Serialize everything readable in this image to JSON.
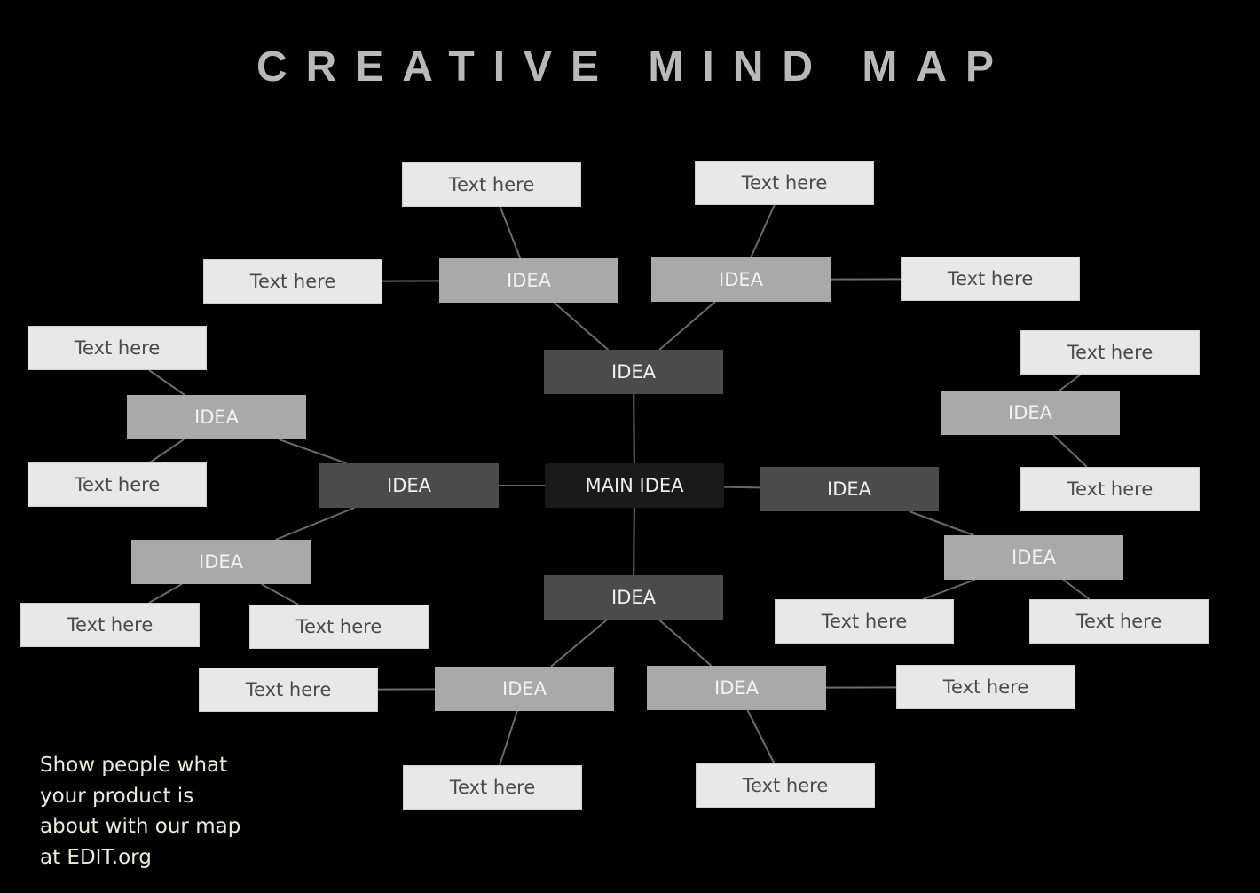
{
  "title": "CREATIVE MIND MAP",
  "colors": {
    "background": "#000000",
    "connector": "#6a6a6a"
  },
  "nodes": [
    {
      "id": "main",
      "label": "MAIN IDEA",
      "kind": "main"
    },
    {
      "id": "top",
      "label": "IDEA",
      "kind": "primary"
    },
    {
      "id": "left",
      "label": "IDEA",
      "kind": "primary"
    },
    {
      "id": "right",
      "label": "IDEA",
      "kind": "primary"
    },
    {
      "id": "bottom",
      "label": "IDEA",
      "kind": "primary"
    },
    {
      "id": "top-sub-left",
      "label": "IDEA",
      "kind": "sub"
    },
    {
      "id": "top-sub-right",
      "label": "IDEA",
      "kind": "sub"
    },
    {
      "id": "left-sub-top",
      "label": "IDEA",
      "kind": "sub"
    },
    {
      "id": "left-sub-bottom",
      "label": "IDEA",
      "kind": "sub"
    },
    {
      "id": "right-sub-top",
      "label": "IDEA",
      "kind": "sub"
    },
    {
      "id": "right-sub-bottom",
      "label": "IDEA",
      "kind": "sub"
    },
    {
      "id": "bottom-sub-left",
      "label": "IDEA",
      "kind": "sub"
    },
    {
      "id": "bottom-sub-right",
      "label": "IDEA",
      "kind": "sub"
    },
    {
      "id": "t1",
      "label": "Text here",
      "kind": "text"
    },
    {
      "id": "t2",
      "label": "Text here",
      "kind": "text"
    },
    {
      "id": "t3",
      "label": "Text here",
      "kind": "text"
    },
    {
      "id": "t4",
      "label": "Text here",
      "kind": "text"
    },
    {
      "id": "t5",
      "label": "Text here",
      "kind": "text"
    },
    {
      "id": "t6",
      "label": "Text here",
      "kind": "text"
    },
    {
      "id": "t7",
      "label": "Text here",
      "kind": "text"
    },
    {
      "id": "t8",
      "label": "Text here",
      "kind": "text"
    },
    {
      "id": "t9",
      "label": "Text here",
      "kind": "text"
    },
    {
      "id": "t10",
      "label": "Text here",
      "kind": "text"
    },
    {
      "id": "t11",
      "label": "Text here",
      "kind": "text"
    },
    {
      "id": "t12",
      "label": "Text here",
      "kind": "text"
    },
    {
      "id": "t13",
      "label": "Text here",
      "kind": "text"
    },
    {
      "id": "t14",
      "label": "Text here",
      "kind": "text"
    },
    {
      "id": "t15",
      "label": "Text here",
      "kind": "text"
    },
    {
      "id": "t16",
      "label": "Text here",
      "kind": "text"
    }
  ],
  "edges": [
    [
      "main",
      "top"
    ],
    [
      "main",
      "left"
    ],
    [
      "main",
      "right"
    ],
    [
      "main",
      "bottom"
    ],
    [
      "top",
      "top-sub-left"
    ],
    [
      "top",
      "top-sub-right"
    ],
    [
      "top-sub-left",
      "t1"
    ],
    [
      "top-sub-left",
      "t3"
    ],
    [
      "top-sub-right",
      "t2"
    ],
    [
      "top-sub-right",
      "t4"
    ],
    [
      "left",
      "left-sub-top"
    ],
    [
      "left",
      "left-sub-bottom"
    ],
    [
      "left-sub-top",
      "t5"
    ],
    [
      "left-sub-top",
      "t6"
    ],
    [
      "left-sub-bottom",
      "t7"
    ],
    [
      "left-sub-bottom",
      "t8"
    ],
    [
      "right",
      "right-sub-bottom"
    ],
    [
      "right-sub-top",
      "t9"
    ],
    [
      "right-sub-top",
      "t10"
    ],
    [
      "right-sub-bottom",
      "t11"
    ],
    [
      "right-sub-bottom",
      "t12"
    ],
    [
      "bottom",
      "bottom-sub-left"
    ],
    [
      "bottom",
      "bottom-sub-right"
    ],
    [
      "bottom-sub-left",
      "t13"
    ],
    [
      "bottom-sub-left",
      "t15"
    ],
    [
      "bottom-sub-right",
      "t14"
    ],
    [
      "bottom-sub-right",
      "t16"
    ]
  ],
  "promo_lines": [
    "Show people what",
    "your product is",
    "about with our map",
    "at EDIT.org"
  ]
}
